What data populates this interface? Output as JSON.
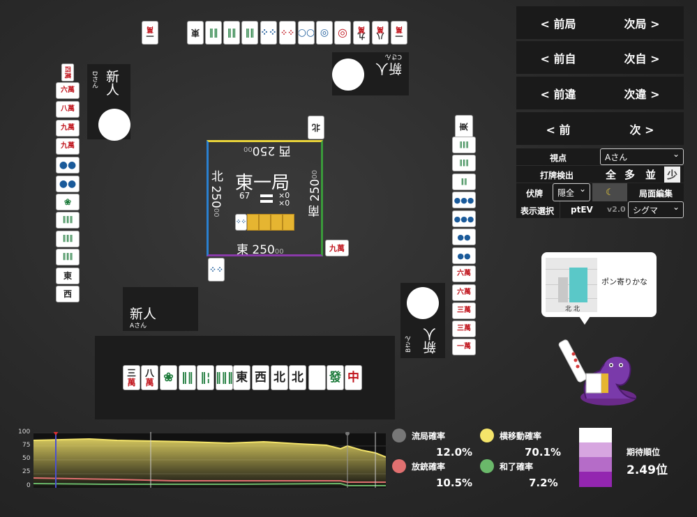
{
  "north_player": {
    "name": "新人",
    "sub": "Cさん"
  },
  "west_player": {
    "name": "新人",
    "sub": "Dさん"
  },
  "south_player": {
    "name": "新人",
    "sub": "Aさん"
  },
  "east_player": {
    "name": "新人",
    "sub": "Bさん"
  },
  "center": {
    "round": "東一局",
    "remaining": "67",
    "honba_a": "×0",
    "honba_b": "×0",
    "score_north": "西 250",
    "score_north_small": "00",
    "score_west": "北 250",
    "score_west_small": "00",
    "score_east": "南 250",
    "score_east_small": "00",
    "score_south": "東 250",
    "score_south_small": "00"
  },
  "nav": {
    "prev_round": "< 前局",
    "next_round": "次局 >",
    "prev_self": "< 前自",
    "next_self": "次自 >",
    "prev_mistake": "< 前違",
    "next_mistake": "次違 >",
    "prev": "< 前",
    "next": "次 >"
  },
  "controls": {
    "viewpoint_label": "視点",
    "viewpoint_value": "Aさん",
    "discard_detect_label": "打牌検出",
    "discard_modes": [
      "全",
      "多",
      "並",
      "少"
    ],
    "hidden_label": "伏牌",
    "hidden_value": "隠全",
    "moon_icon": "moon-icon",
    "board_edit": "局面編集",
    "display_select_label": "表示選択",
    "display_select_value": "ptEV",
    "version": "v2.0",
    "ai_value": "シグマ"
  },
  "bubble": {
    "text": "ポン寄りかな",
    "bar_labels": [
      "北",
      "北"
    ]
  },
  "chart": {
    "y_ticks": [
      "100",
      "75",
      "50",
      "25",
      "0"
    ]
  },
  "stats": {
    "ryukyoku_label": "流局確率",
    "ryukyoku_value": "12.0%",
    "yokoido_label": "横移動確率",
    "yokoido_value": "70.1%",
    "houju_label": "放銃確率",
    "houju_value": "10.5%",
    "hora_label": "和了確率",
    "hora_value": "7.2%",
    "expected_rank_label": "期待順位",
    "expected_rank_value": "2.49位"
  },
  "colors": {
    "ryukyoku": "#777777",
    "yokoido": "#f4e46a",
    "houju": "#e07070",
    "hora": "#6ab86a",
    "rank_1": "#ffffff",
    "rank_2": "#d7a6e0",
    "rank_3": "#b56cc8",
    "rank_4": "#9326b0"
  },
  "hand_tiles": [
    {
      "top": "三",
      "bot": "萬",
      "cls": ""
    },
    {
      "top": "八",
      "bot": "萬",
      "cls": ""
    },
    {
      "top": "❀",
      "bot": "",
      "cls": "green"
    },
    {
      "top": "‖‖",
      "bot": "",
      "cls": "sou"
    },
    {
      "top": "‖¦",
      "bot": "",
      "cls": "sou"
    },
    {
      "top": "‖‖‖",
      "bot": "",
      "cls": "sou"
    },
    {
      "top": "東",
      "bot": "",
      "cls": ""
    },
    {
      "top": "西",
      "bot": "",
      "cls": ""
    },
    {
      "top": "北",
      "bot": "",
      "cls": ""
    },
    {
      "top": "北",
      "bot": "",
      "cls": ""
    },
    {
      "top": "",
      "bot": "",
      "cls": "blank"
    },
    {
      "top": "發",
      "bot": "",
      "cls": "green"
    },
    {
      "top": "中",
      "bot": "",
      "cls": "red"
    }
  ],
  "north_tiles": [
    "一萬",
    "八萬",
    "九萬",
    "◎",
    "◎",
    "○○",
    "⁘⁘",
    "⁘⁘",
    "‖‖",
    "‖‖",
    "‖‖",
    "東"
  ],
  "west_tiles": [
    "四萬",
    "六萬",
    "八萬",
    "九萬",
    "九萬",
    "●●",
    "●●",
    "❀",
    "‖‖",
    "‖‖",
    "‖‖",
    "東",
    "西"
  ],
  "east_tiles": [
    "東",
    "‖‖",
    "‖‖",
    "‖‖",
    "●●",
    "●●",
    "●●",
    "●●",
    "六萬",
    "六萬",
    "三萬",
    "三萬",
    "一萬"
  ]
}
